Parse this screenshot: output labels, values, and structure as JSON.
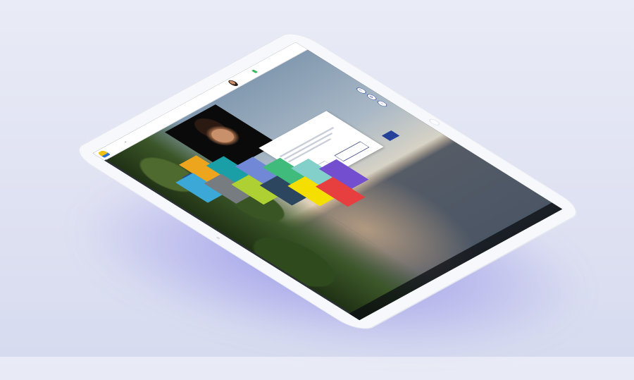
{
  "device": {
    "background_color": "#e5e7f4",
    "glow_color": "#5a5fe1",
    "frame_color": "#f7f8fb"
  },
  "topbar": {
    "breadcrumb": "",
    "badge": ""
  },
  "user": {
    "name": "",
    "role": ""
  },
  "panel": {
    "button": ""
  },
  "info_card": {
    "title": "",
    "left_button": "",
    "right_button": ""
  },
  "primary_button": "",
  "side_label": "",
  "footer": [],
  "tiles": [
    {
      "color": "#eda51d"
    },
    {
      "color": "#3ca8d8"
    },
    {
      "color": "#1a9fa6"
    },
    {
      "color": "#777c80"
    },
    {
      "color": "#7088d6"
    },
    {
      "color": "#aed032"
    },
    {
      "color": "#40bb7c"
    },
    {
      "color": "#2d4660"
    },
    {
      "color": "#82d0c9"
    },
    {
      "color": "#f5df00"
    },
    {
      "color": "#734fd0"
    },
    {
      "color": "#e73f3f"
    }
  ],
  "right_icons": [
    "help-icon",
    "settings-icon",
    "info-icon"
  ]
}
